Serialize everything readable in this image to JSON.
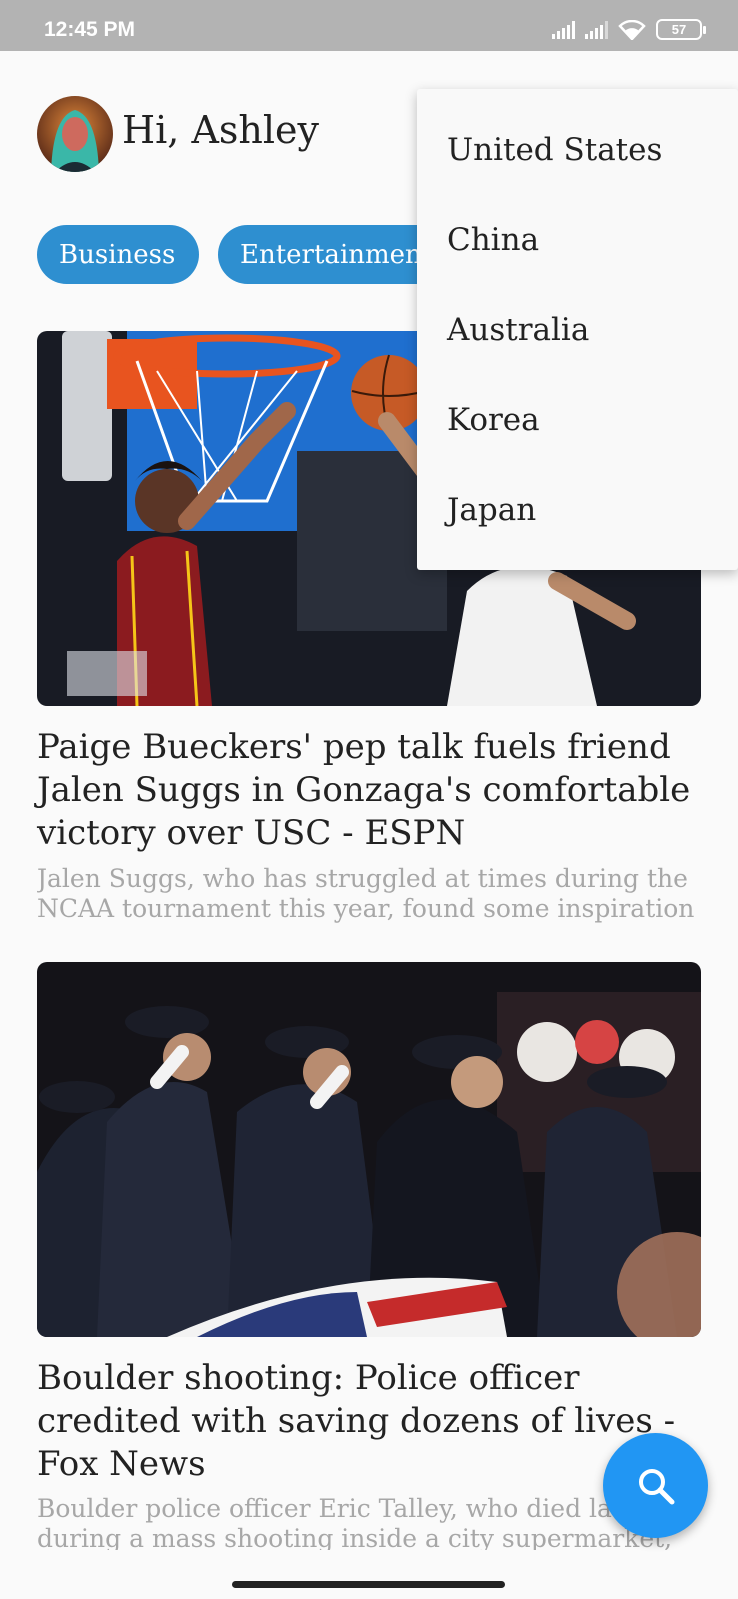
{
  "status_bar": {
    "time": "12:45 PM",
    "battery": "57"
  },
  "header": {
    "greeting": "Hi, Ashley"
  },
  "categories": [
    {
      "label": "Business"
    },
    {
      "label": "Entertainment"
    }
  ],
  "articles": [
    {
      "headline": "Paige Bueckers' pep talk fuels friend Jalen Suggs in Gonzaga's comfortable victory over USC - ESPN",
      "summary": "Jalen Suggs, who has struggled at times during the NCAA tournament this year, found some inspiration"
    },
    {
      "headline": "Boulder shooting: Police officer credited with saving dozens of lives - Fox News",
      "summary": "Boulder police officer Eric Talley, who died last during a mass shooting inside a city supermarket,"
    }
  ],
  "country_menu": {
    "items": [
      "United States",
      "China",
      "Australia",
      "Korea",
      "Japan"
    ]
  },
  "fab": {
    "icon": "search-icon"
  },
  "colors": {
    "accent": "#2196f3",
    "chip": "#2e8fd0",
    "status_bar": "#b3b3b3"
  }
}
